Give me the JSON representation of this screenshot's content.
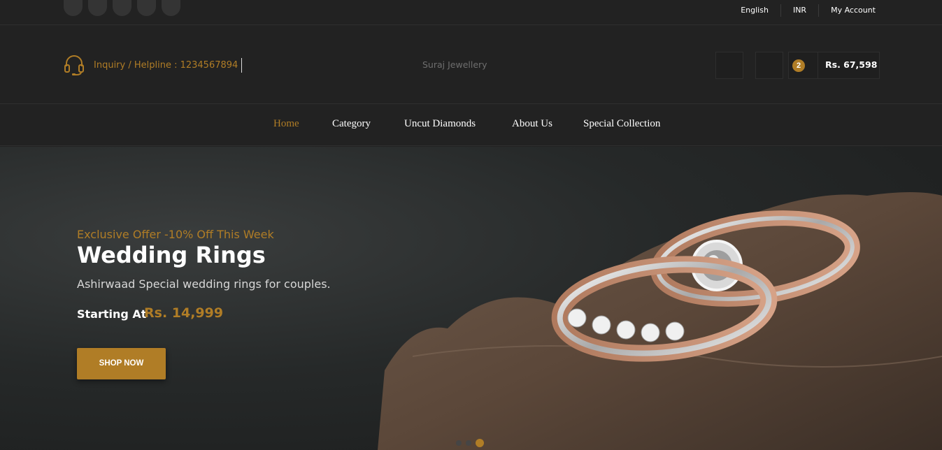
{
  "topbar": {
    "social_icons": [
      "social-icon-1",
      "social-icon-2",
      "social-icon-3",
      "social-icon-4",
      "social-icon-5"
    ],
    "language": "English",
    "currency": "INR",
    "account": "My Account"
  },
  "header": {
    "helpline_icon": "headset-icon",
    "helpline": "Inquiry / Helpline : 1234567894",
    "store_name": "Suraj Jewellery",
    "cart_count": "2",
    "cart_total": "Rs. 67,598"
  },
  "nav": {
    "items": [
      {
        "label": "Home"
      },
      {
        "label": "Category"
      },
      {
        "label": "Uncut Diamonds"
      },
      {
        "label": "About Us"
      },
      {
        "label": "Special Collection"
      }
    ]
  },
  "hero": {
    "offer": "Exclusive Offer -10% Off This Week",
    "title": "Wedding Rings",
    "subtitle": "Ashirwaad Special wedding rings for couples.",
    "starting_label": "Starting At",
    "price": "Rs. 14,999",
    "cta": "SHOP NOW",
    "slides": 3,
    "active_slide": 3
  },
  "colors": {
    "accent": "#b07d26",
    "background": "#222222",
    "text": "#ffffff"
  }
}
